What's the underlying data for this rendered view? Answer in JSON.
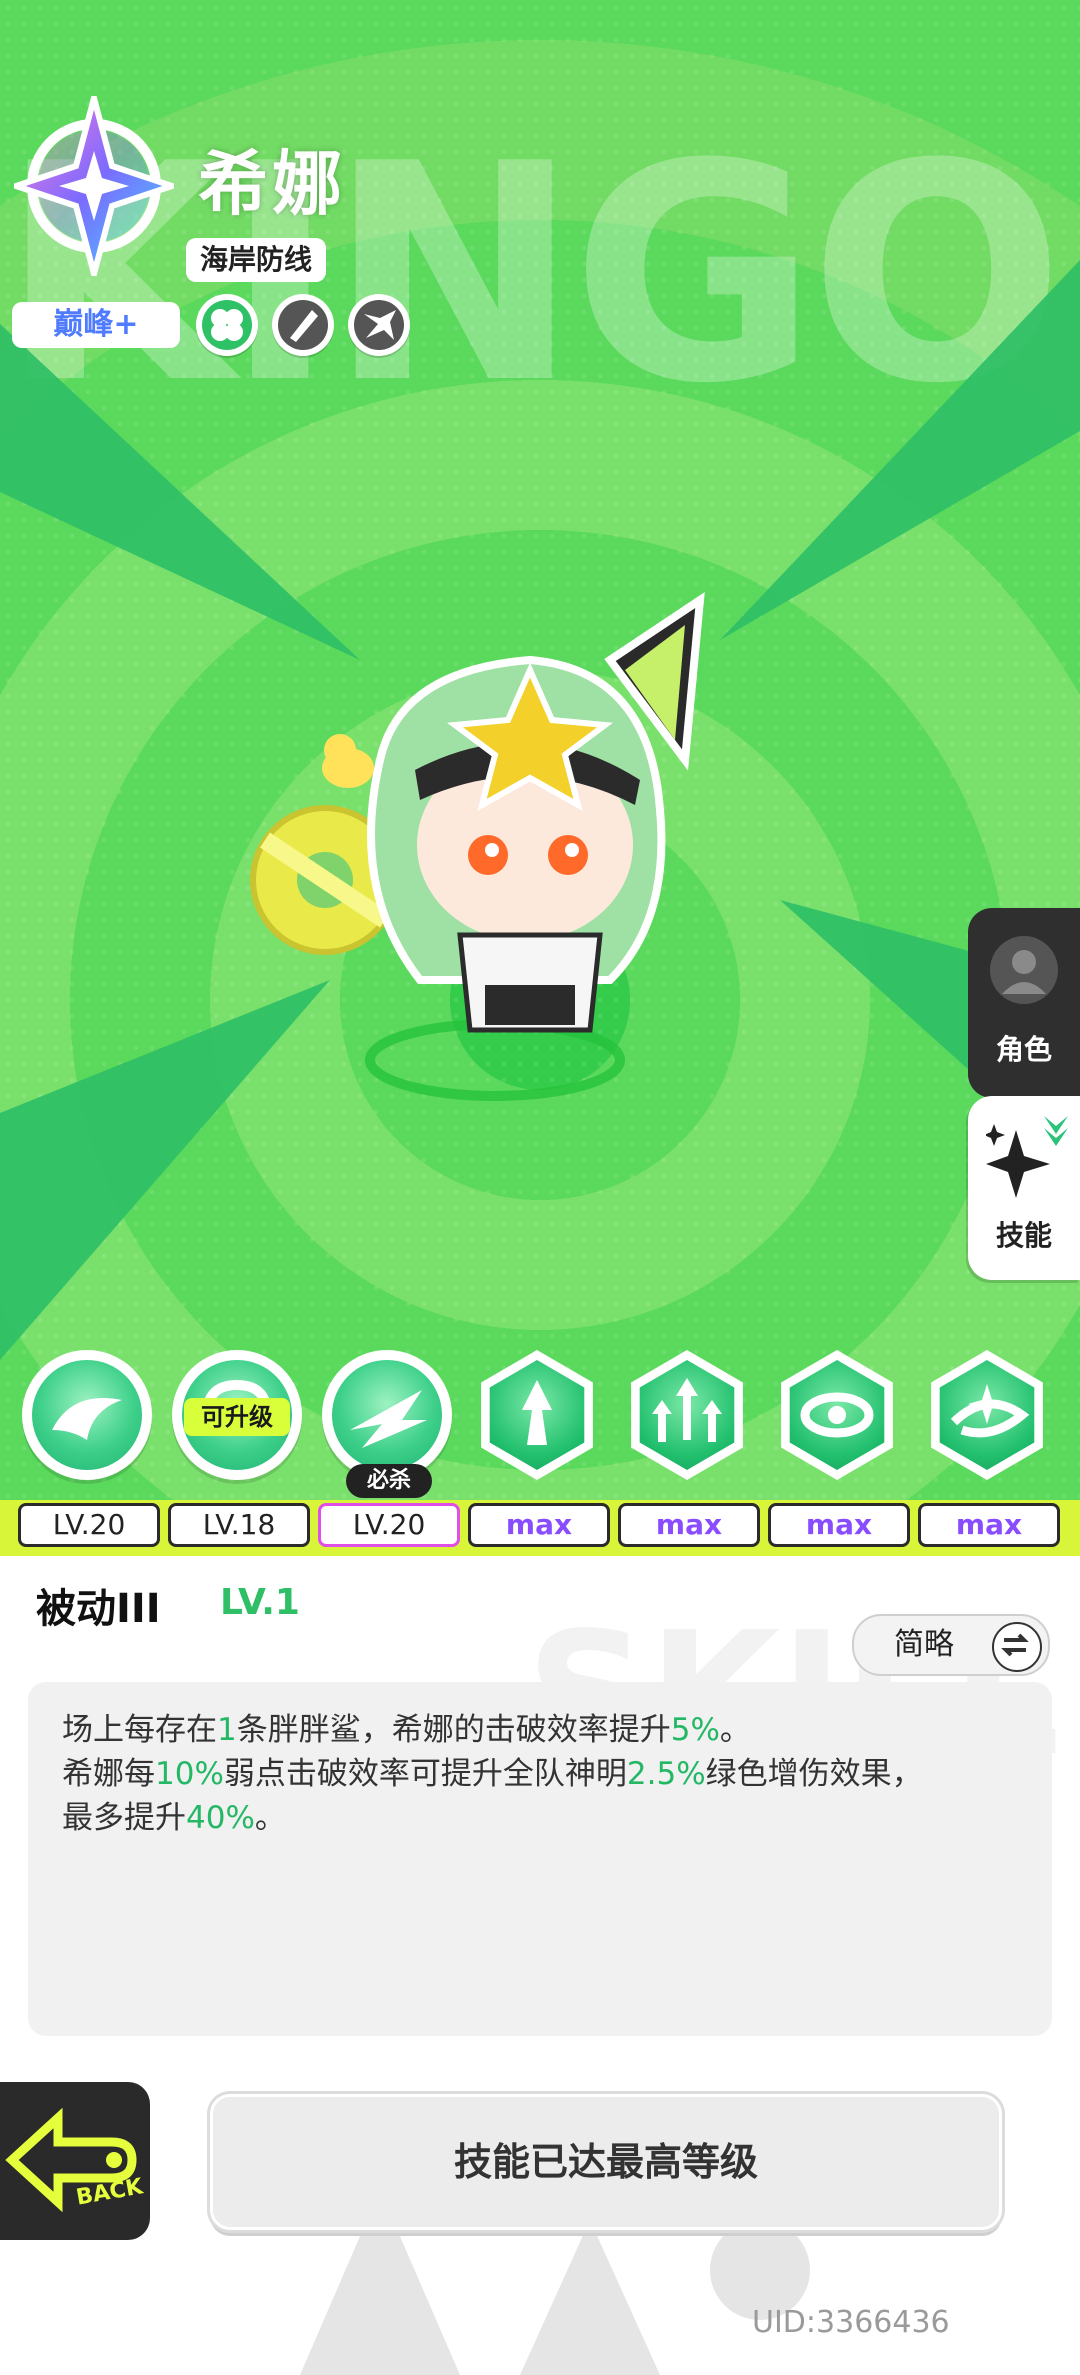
{
  "character": {
    "name": "希娜",
    "faction": "海岸防线",
    "rank": "巅峰+",
    "watermark": "KINGOD"
  },
  "side_tabs": [
    {
      "label": "角色",
      "icon": "avatar-icon",
      "active": false
    },
    {
      "label": "技能",
      "icon": "sparkle-star-icon",
      "active": true
    }
  ],
  "skills": [
    {
      "level": "LV.20",
      "tag": "",
      "icon": "shark-wave-icon",
      "shape": "circle"
    },
    {
      "level": "LV.18",
      "tag": "可升级",
      "icon": "swirl-icon",
      "shape": "circle"
    },
    {
      "level": "LV.20",
      "tag": "必杀",
      "icon": "slash-burst-icon",
      "shape": "circle",
      "selected": true
    },
    {
      "level": "max",
      "tag": "",
      "icon": "arrow-burst-icon",
      "shape": "hex"
    },
    {
      "level": "max",
      "tag": "",
      "icon": "triple-arrow-icon",
      "shape": "hex"
    },
    {
      "level": "max",
      "tag": "",
      "icon": "vortex-icon",
      "shape": "hex"
    },
    {
      "level": "max",
      "tag": "",
      "icon": "spiral-star-icon",
      "shape": "hex"
    }
  ],
  "detail": {
    "title": "被动III",
    "level": "LV.1",
    "toggle_label": "简略",
    "watermark": "SKILL",
    "line1": {
      "a": "场上每存在",
      "v1": "1",
      "b": "条胖胖鲨，希娜的击破效率提升",
      "v2": "5%",
      "c": "。"
    },
    "line2": {
      "a": "希娜每",
      "v1": "10%",
      "b": "弱点击破效率可提升全队神明",
      "v2": "2.5%",
      "c": "绿色增伤效果，"
    },
    "line3": {
      "a": "最多提升",
      "v1": "40%",
      "b": "。"
    }
  },
  "footer": {
    "back_label": "BACK",
    "action_label": "技能已达最高等级",
    "uid": "UID:3366436"
  },
  "colors": {
    "accent_green": "#24b865",
    "level_strip": "#d9f53a",
    "max_text": "#8a4cff"
  }
}
